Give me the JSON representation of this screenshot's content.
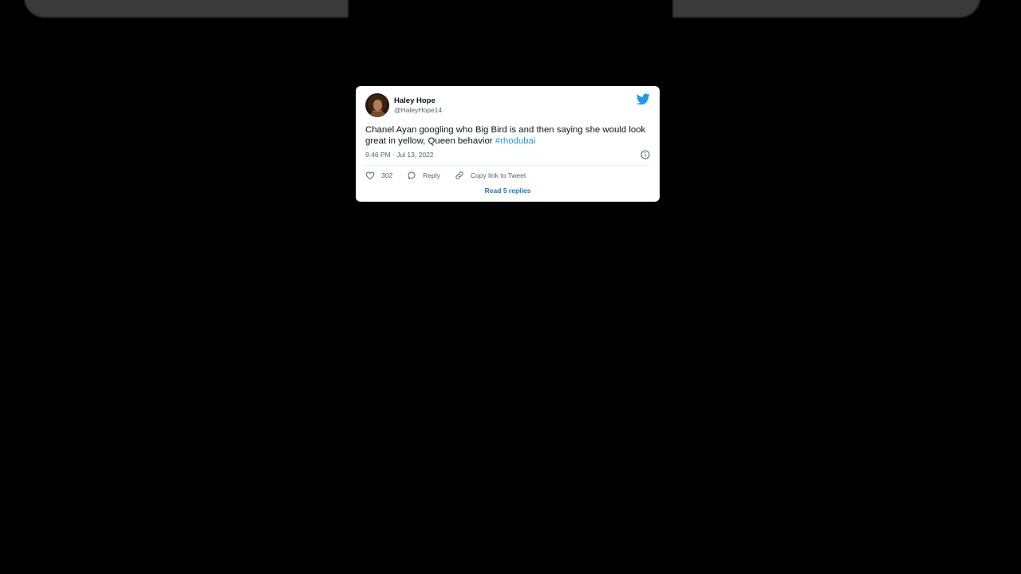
{
  "tweet": {
    "display_name": "Haley Hope",
    "handle": "@HaleyHope14",
    "text": "Chanel Ayan googling who Big Bird is and then saying she would look great in yellow, Queen behavior ",
    "hashtag": "#rhodubai",
    "timestamp": "9:46 PM · Jul 13, 2022",
    "like_count": "302",
    "reply_label": "Reply",
    "copy_link_label": "Copy link to Tweet",
    "read_replies_label": "Read 5 replies"
  },
  "icons": {
    "brand": "twitter-bird-icon",
    "info": "info-icon",
    "like": "heart-icon",
    "reply": "speech-bubble-icon",
    "copy": "link-icon"
  },
  "colors": {
    "background": "#000000",
    "card": "#ffffff",
    "brand_blue": "#1d9bf0",
    "link_blue": "#1d75bd",
    "secondary_text": "#536471",
    "primary_text": "#0f1419"
  }
}
